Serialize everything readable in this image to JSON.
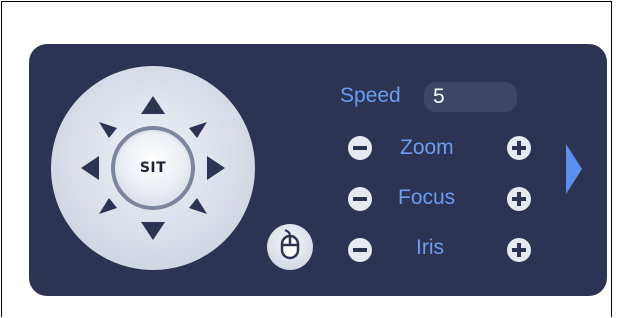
{
  "window": {
    "title": ""
  },
  "ptz": {
    "center_button": {
      "label": "SIT"
    },
    "directions": [
      "up",
      "up-right",
      "right",
      "down-right",
      "down",
      "down-left",
      "left",
      "up-left"
    ],
    "mouse_icon": "mouse-icon"
  },
  "speed": {
    "label": "Speed",
    "value": "5"
  },
  "controls": [
    {
      "id": "zoom",
      "label": "Zoom"
    },
    {
      "id": "focus",
      "label": "Focus"
    },
    {
      "id": "iris",
      "label": "Iris"
    }
  ],
  "colors": {
    "panel": "#2d3352",
    "label": "#6a9cf2",
    "arrow": "#2d3352",
    "expand_arrow": "#5b8ff0"
  }
}
